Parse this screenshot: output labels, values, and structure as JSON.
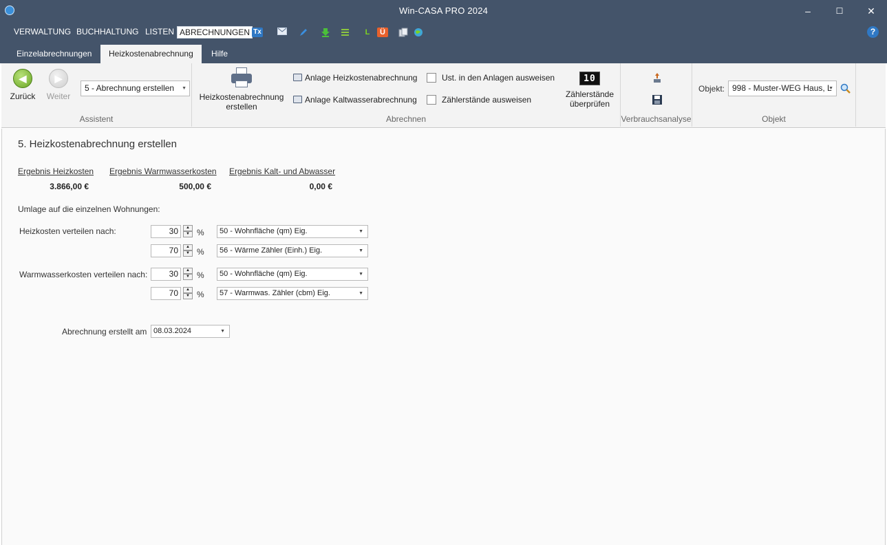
{
  "window": {
    "title": "Win-CASA PRO 2024",
    "minimize": "–",
    "maximize": "☐",
    "close": "✕"
  },
  "menu": {
    "items": [
      "VERWALTUNG",
      "BUCHHALTUNG",
      "LISTEN",
      "ABRECHNUNGEN"
    ],
    "active": "ABRECHNUNGEN",
    "tx_label": "Tx",
    "l_label": "L",
    "u_label": "Ü",
    "help": "?"
  },
  "tabs": {
    "items": [
      "Einzelabrechnungen",
      "Heizkostenabrechnung",
      "Hilfe"
    ],
    "active": "Heizkostenabrechnung"
  },
  "ribbon": {
    "assistent": {
      "back_label": "Zurück",
      "next_label": "Weiter",
      "step_value": "5 - Abrechnung erstellen",
      "group_label": "Assistent"
    },
    "abrechnen": {
      "create_label_1": "Heizkostenabrechnung",
      "create_label_2": "erstellen",
      "anlage_heiz": "Anlage Heizkostenabrechnung",
      "anlage_kalt": "Anlage Kaltwasserabrechnung",
      "ust_check": "Ust. in den Anlagen ausweisen",
      "zaehler_check": "Zählerstände ausweisen",
      "zaehler_btn_1": "Zählerstände",
      "zaehler_btn_2": "überprüfen",
      "counter_glyph": "10",
      "group_label": "Abrechnen"
    },
    "verbrauch": {
      "group_label": "Verbrauchsanalyse"
    },
    "objekt": {
      "label": "Objekt:",
      "value": "998 - Muster-WEG Haus, L",
      "group_label": "Objekt"
    }
  },
  "content": {
    "title": "5. Heizkostenabrechnung erstellen",
    "results": [
      {
        "heading": "Ergebnis Heizkosten",
        "value": "3.866,00 €"
      },
      {
        "heading": "Ergebnis Warmwasserkosten",
        "value": "500,00 €"
      },
      {
        "heading": "Ergebnis Kalt- und Abwasser",
        "value": "0,00 €"
      }
    ],
    "umlage_label": "Umlage auf die einzelnen Wohnungen:",
    "heiz": {
      "label": "Heizkosten verteilen nach:",
      "row1": {
        "value": "30",
        "unit": "%",
        "key": "50 - Wohnfläche (qm) Eig."
      },
      "row2": {
        "value": "70",
        "unit": "%",
        "key": "56 - Wärme Zähler (Einh.) Eig."
      }
    },
    "warm": {
      "label": "Warmwasserkosten verteilen nach:",
      "row1": {
        "value": "30",
        "unit": "%",
        "key": "50 - Wohnfläche (qm) Eig."
      },
      "row2": {
        "value": "70",
        "unit": "%",
        "key": "57 - Warmwas. Zähler (cbm) Eig."
      }
    },
    "date_label": "Abrechnung erstellt am",
    "date_value": "08.03.2024"
  },
  "colors": {
    "chrome": "#44546a",
    "ribbon": "#f3f3f3",
    "accent_green": "#6aa524",
    "help_blue": "#2f78c4"
  }
}
